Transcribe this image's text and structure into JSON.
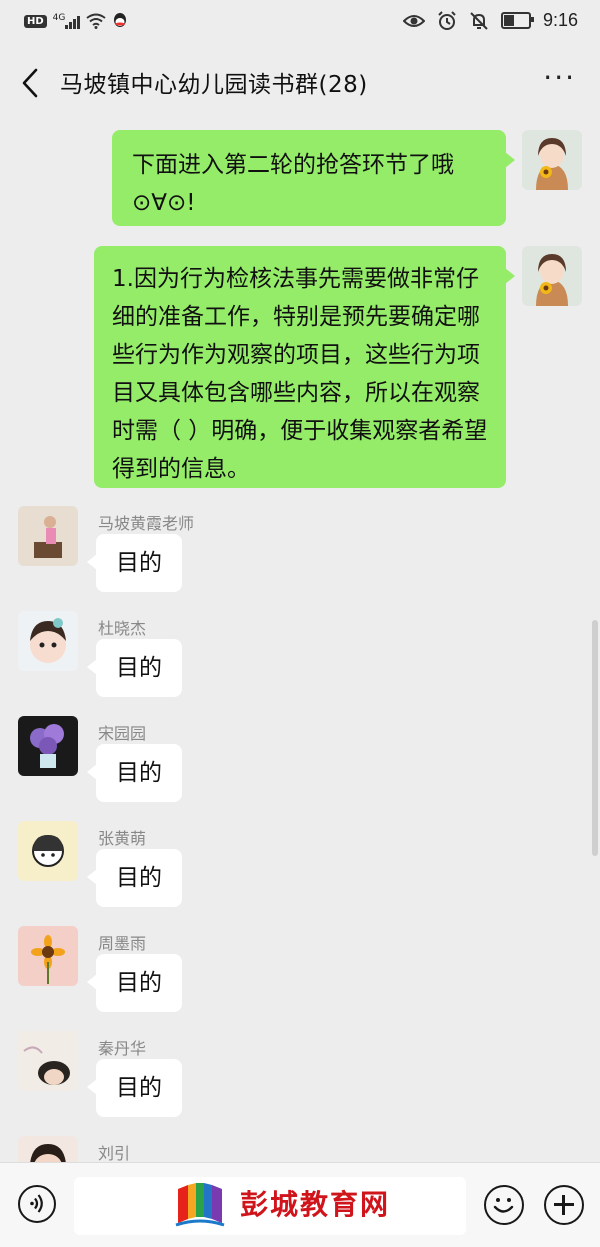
{
  "status_bar": {
    "hd": "HD",
    "net": "4G",
    "time": "9:16"
  },
  "header": {
    "title": "马坡镇中心幼儿园读书群(28)",
    "more": "···"
  },
  "messages": {
    "outgoing": [
      {
        "text": "下面进入第二轮的抢答环节了哦⊙∀⊙!"
      },
      {
        "text": "1.因为行为检核法事先需要做非常仔细的准备工作，特别是预先要确定哪些行为作为观察的项目，这些行为项目又具体包含哪些内容，所以在观察时需（    ）明确，便于收集观察者希望得到的信息。"
      }
    ],
    "incoming": [
      {
        "sender": "马坡黄霞老师",
        "text": "目的"
      },
      {
        "sender": "杜晓杰",
        "text": "目的"
      },
      {
        "sender": "宋园园",
        "text": "目的"
      },
      {
        "sender": "张黄萌",
        "text": "目的"
      },
      {
        "sender": "周墨雨",
        "text": "目的"
      },
      {
        "sender": "秦丹华",
        "text": "目的"
      },
      {
        "sender": "刘引",
        "text": ""
      }
    ]
  },
  "watermark": {
    "text": "彭城教育网"
  },
  "icons": {
    "back": "back-arrow-icon",
    "voice": "voice-icon",
    "emoji": "emoji-icon",
    "plus": "plus-icon"
  },
  "colors": {
    "outgoing_bubble": "#95ec69",
    "incoming_bubble": "#ffffff",
    "background": "#ededed"
  }
}
